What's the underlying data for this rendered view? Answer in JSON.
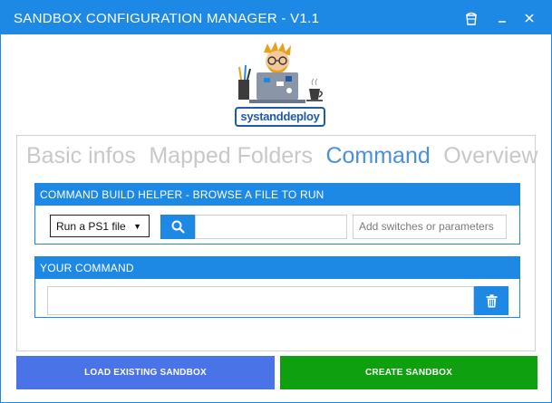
{
  "window": {
    "title": "SANDBOX CONFIGURATION MANAGER - V1.1"
  },
  "logo": {
    "text": "systanddeploy"
  },
  "tabs": [
    {
      "label": "Basic infos"
    },
    {
      "label": "Mapped Folders"
    },
    {
      "label": "Command"
    },
    {
      "label": "Overview"
    }
  ],
  "build_helper": {
    "header": "COMMAND BUILD HELPER - BROWSE A FILE TO RUN",
    "file_type_selected": "Run a PS1 file",
    "file_value": "",
    "params_placeholder": "Add switches or parameters"
  },
  "your_command": {
    "header": "YOUR COMMAND",
    "value": ""
  },
  "buttons": {
    "load_label": "LOAD EXISTING SANDBOX",
    "create_label": "CREATE SANDBOX"
  },
  "colors": {
    "accent": "#1e88e5",
    "active_tab": "#4a90d9",
    "inactive_tab": "#c8c8c8",
    "load_button": "#4a73e8",
    "create_button": "#0fa00f"
  },
  "icons": {
    "titlebar": [
      "bucket-icon",
      "minimize-icon",
      "close-icon"
    ],
    "search": "search-icon",
    "delete": "trash-icon"
  }
}
